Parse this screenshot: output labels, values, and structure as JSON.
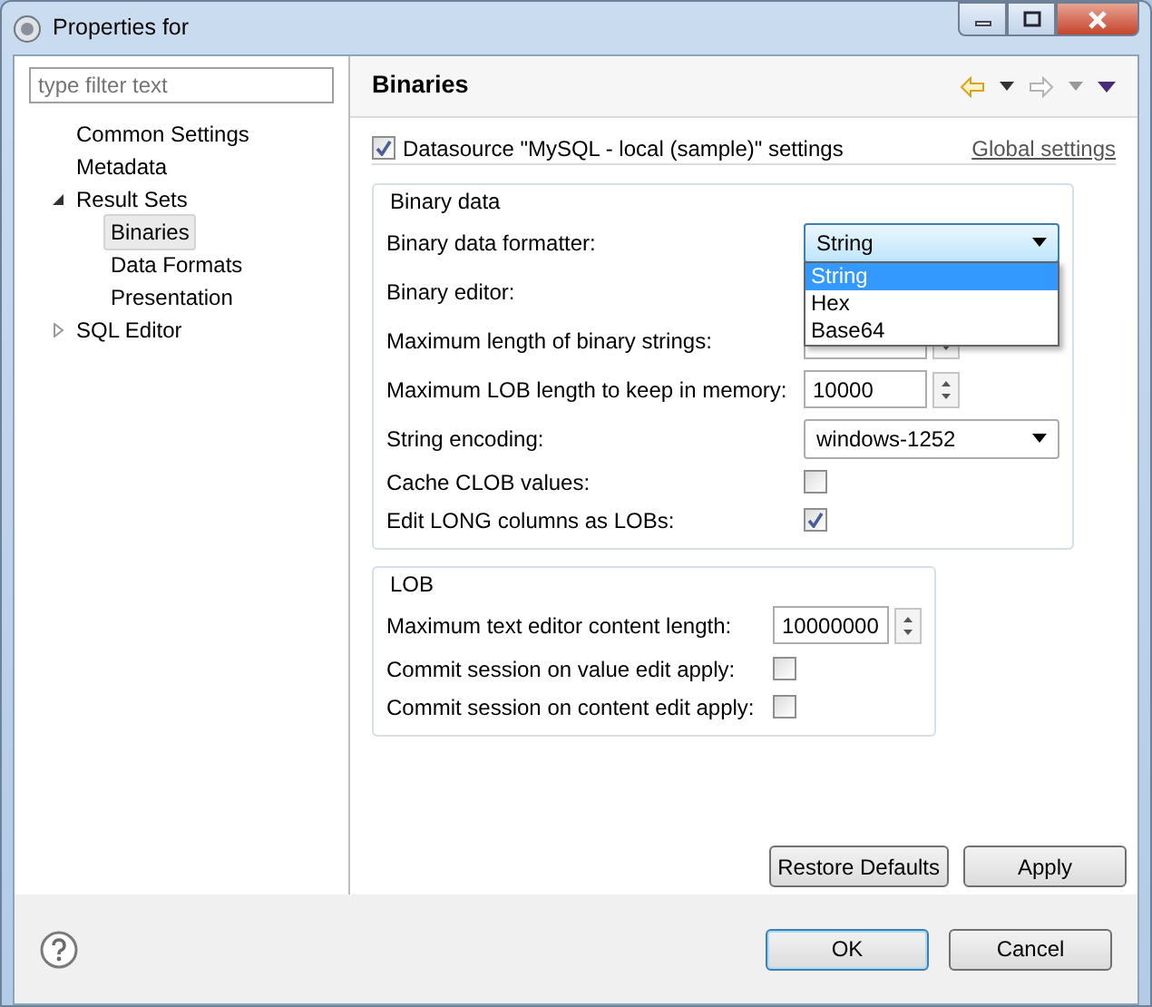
{
  "window": {
    "title": "Properties for"
  },
  "filter": {
    "placeholder": "type filter text"
  },
  "tree": [
    {
      "label": "Common Settings",
      "selected": false
    },
    {
      "label": "Metadata",
      "selected": false
    },
    {
      "label": "Result Sets",
      "selected": false,
      "expanded": true,
      "children": [
        {
          "label": "Binaries",
          "selected": true
        },
        {
          "label": "Data Formats",
          "selected": false
        },
        {
          "label": "Presentation",
          "selected": false
        }
      ]
    },
    {
      "label": "SQL Editor",
      "selected": false,
      "expanded": false
    }
  ],
  "page": {
    "title": "Binaries",
    "datasource": {
      "label": "Datasource \"MySQL - local (sample)\" settings",
      "checked": true
    },
    "global_link": "Global settings",
    "groups": [
      {
        "title": "Binary data",
        "rows": [
          {
            "kind": "combo",
            "label": "Binary data formatter:",
            "value": "String",
            "open": true,
            "options": [
              {
                "label": "String",
                "selected": true
              },
              {
                "label": "Hex",
                "selected": false
              },
              {
                "label": "Base64",
                "selected": false
              }
            ]
          },
          {
            "kind": "hidden",
            "label": "Binary editor:"
          },
          {
            "kind": "spinner",
            "label": "Maximum length of binary strings:"
          },
          {
            "kind": "spinner",
            "label": "Maximum LOB length to keep in memory:",
            "value": "10000"
          },
          {
            "kind": "combo",
            "label": "String encoding:",
            "value": "windows-1252",
            "open": false
          },
          {
            "kind": "check",
            "label": "Cache CLOB values:",
            "checked": false
          },
          {
            "kind": "check",
            "label": "Edit LONG columns as LOBs:",
            "checked": true
          }
        ]
      },
      {
        "title": "LOB",
        "rows": [
          {
            "kind": "spinner",
            "label": "Maximum text editor content length:",
            "value": "10000000"
          },
          {
            "kind": "check",
            "label": "Commit session on value edit apply:",
            "checked": false
          },
          {
            "kind": "check",
            "label": "Commit session on content edit apply:",
            "checked": false
          }
        ]
      }
    ],
    "buttons": [
      "Restore Defaults",
      "Apply"
    ]
  },
  "dialog_buttons": [
    {
      "label": "OK",
      "default": true
    },
    {
      "label": "Cancel",
      "default": false
    }
  ]
}
